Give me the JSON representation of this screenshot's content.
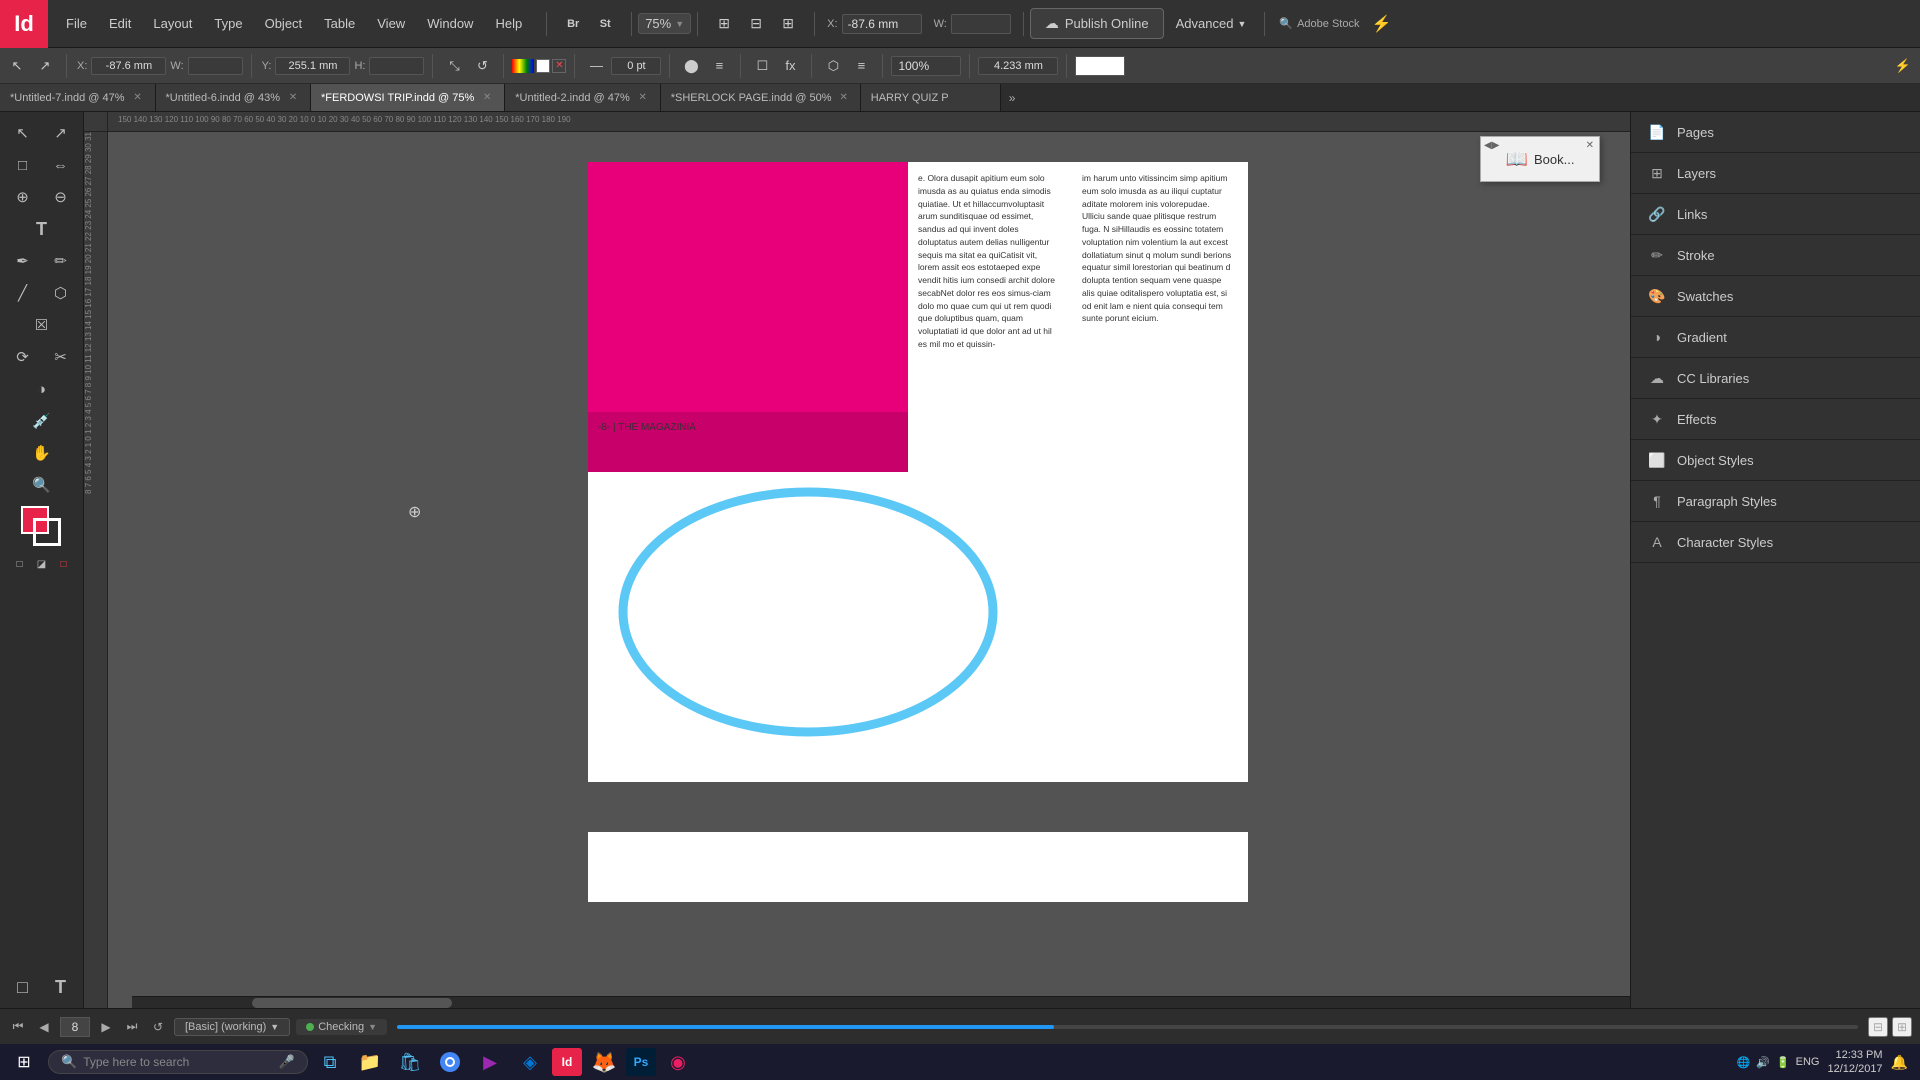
{
  "app": {
    "logo": "Id",
    "title": "Adobe InDesign"
  },
  "menubar": {
    "items": [
      "File",
      "Edit",
      "Layout",
      "Type",
      "Object",
      "Table",
      "View",
      "Window",
      "Help"
    ]
  },
  "toolbar": {
    "bridge_label": "Br",
    "stock_label": "St",
    "zoom_value": "75%",
    "publish_label": "Publish Online",
    "advanced_label": "Advanced",
    "adobe_stock_label": "Adobe Stock",
    "x_label": "X:",
    "x_value": "-87.6 mm",
    "y_label": "Y:",
    "y_value": "255.1 mm",
    "w_label": "W:",
    "h_label": "H:",
    "stroke_value": "0 pt",
    "percent_value": "100%",
    "size_value": "4.233 mm"
  },
  "tabs": [
    {
      "id": "tab1",
      "label": "*Untitled-7.indd @ 47%",
      "active": false
    },
    {
      "id": "tab2",
      "label": "*Untitled-6.indd @ 43%",
      "active": false
    },
    {
      "id": "tab3",
      "label": "*FERDOWSI TRIP.indd @ 75%",
      "active": true
    },
    {
      "id": "tab4",
      "label": "*Untitled-2.indd @ 47%",
      "active": false
    },
    {
      "id": "tab5",
      "label": "*SHERLOCK PAGE.indd @ 50%",
      "active": false
    },
    {
      "id": "tab6",
      "label": "HARRY QUIZ P",
      "active": false
    }
  ],
  "canvas": {
    "page_label": "-8- | THE MAGAZINIA",
    "zoom_cursor": "🔍",
    "book_popup_label": "Book...",
    "text_column_sample": "e. Olora dusapit apitium eum solo imusda as au quiatus enda simodis quiatiae. Ut et hillaccumvoluptasit arum sunditisquae od essimet, sandus ad qui invent doles doluptatus autem delias nulligentur sequis ma sitat ea quiCatisit vit, lorem assit eos estotaeped expe vendit hitis ium consedi archit dolore secabNet dolor res eos simus-ciam dolo mo quae cum qui ut rem quodi que doluptibus quam, quam voluptatiati id que dolor ant ad ut hil es mil mo et quissin-",
    "text_column_right": "im harum unto vitissincim simp apitium eum solo imusda as au iliqui cuptatur aditate molorem inis volorepudae. Ulliciu sande quae plitisque restrum fuga. N siHillaudis es eossinc totatem voluptation nim volentium la aut excest dollatiatum sinut q molum sundi berions equatur simil lorestorian qui beatinum d dolupta tention sequam vene quaspe alis quiae oditalispero voluptatia est, si od enit lam e nient quia consequi tem sunte porunt eicium."
  },
  "right_panel": {
    "sections": [
      {
        "id": "pages",
        "label": "Pages",
        "icon": "📄"
      },
      {
        "id": "layers",
        "label": "Layers",
        "icon": "⊞"
      },
      {
        "id": "links",
        "label": "Links",
        "icon": "🔗"
      },
      {
        "id": "stroke",
        "label": "Stroke",
        "icon": "✏"
      },
      {
        "id": "swatches",
        "label": "Swatches",
        "icon": "🎨"
      },
      {
        "id": "gradient",
        "label": "Gradient",
        "icon": "◑"
      },
      {
        "id": "cc_libraries",
        "label": "CC Libraries",
        "icon": "☁"
      },
      {
        "id": "effects",
        "label": "Effects",
        "icon": "✦"
      },
      {
        "id": "object_styles",
        "label": "Object Styles",
        "icon": "⬜"
      },
      {
        "id": "paragraph_styles",
        "label": "Paragraph Styles",
        "icon": "¶"
      },
      {
        "id": "character_styles",
        "label": "Character Styles",
        "icon": "A"
      }
    ]
  },
  "status_bar": {
    "page_number": "8",
    "style_label": "[Basic] (working)",
    "checking_label": "Checking",
    "nav_first": "⏮",
    "nav_prev": "◀",
    "nav_next": "▶",
    "nav_last": "⏭"
  },
  "taskbar": {
    "start_icon": "⊞",
    "search_placeholder": "Type here to search",
    "search_icon": "🔍",
    "mic_icon": "🎤",
    "apps": [
      {
        "id": "taskview",
        "icon": "⧉",
        "label": "Task View"
      },
      {
        "id": "explorer",
        "icon": "📁",
        "label": "File Explorer"
      },
      {
        "id": "store",
        "icon": "🛍",
        "label": "Microsoft Store"
      },
      {
        "id": "chrome",
        "icon": "◎",
        "label": "Chrome"
      },
      {
        "id": "media",
        "icon": "▶",
        "label": "Media Player"
      },
      {
        "id": "edge",
        "icon": "◈",
        "label": "Edge"
      },
      {
        "id": "indesign",
        "icon": "Id",
        "label": "InDesign"
      },
      {
        "id": "firefox",
        "icon": "🦊",
        "label": "Firefox"
      },
      {
        "id": "photoshop",
        "icon": "Ps",
        "label": "Photoshop"
      },
      {
        "id": "app10",
        "icon": "◉",
        "label": "App"
      }
    ],
    "system": {
      "language": "ENG",
      "time": "12:33 PM",
      "date": "12/12/2017",
      "notification": "🔔"
    }
  }
}
